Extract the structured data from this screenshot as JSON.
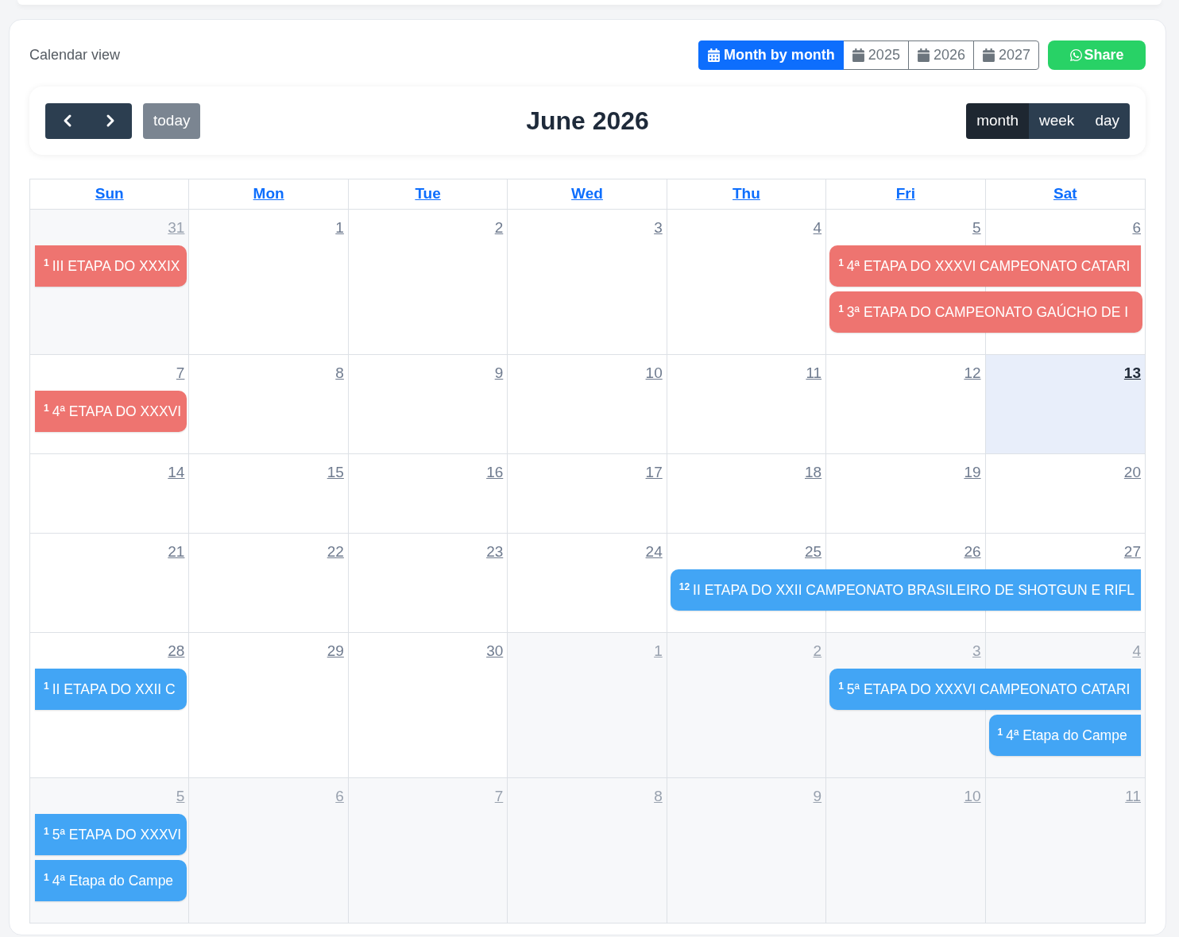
{
  "header": {
    "title": "Calendar view",
    "view_modes": [
      {
        "label": "Month by month",
        "kind": "months",
        "selected": true
      },
      {
        "label": "2025",
        "kind": "year",
        "selected": false
      },
      {
        "label": "2026",
        "kind": "year",
        "selected": false
      },
      {
        "label": "2027",
        "kind": "year",
        "selected": false
      }
    ],
    "share_button": {
      "label": "Share"
    }
  },
  "toolbar": {
    "title": "June 2026",
    "today_button": {
      "label": "today",
      "disabled": true
    },
    "views": [
      {
        "label": "month",
        "selected": true
      },
      {
        "label": "week",
        "selected": false
      },
      {
        "label": "day",
        "selected": false
      }
    ]
  },
  "calendar": {
    "day_headers": [
      "Sun",
      "Mon",
      "Tue",
      "Wed",
      "Thu",
      "Fri",
      "Sat"
    ],
    "weeks": [
      {
        "days": [
          {
            "number": "31",
            "other_month": true,
            "today": false,
            "events": [
              {
                "kind": "event",
                "time": "1",
                "title": "III ETAPA DO XXXIX",
                "color": "#ee7470",
                "continues_before": true,
                "continues_after": false
              }
            ]
          },
          {
            "number": "1",
            "other_month": false,
            "today": false
          },
          {
            "number": "2",
            "other_month": false,
            "today": false
          },
          {
            "number": "3",
            "other_month": false,
            "today": false
          },
          {
            "number": "4",
            "other_month": false,
            "today": false
          },
          {
            "number": "5",
            "other_month": false,
            "today": false,
            "events": [
              {
                "kind": "event",
                "time": "1",
                "title": "4ª ETAPA DO XXXVI CAMPEONATO CATARI",
                "color": "#ee7470",
                "continues_before": false,
                "continues_after": true
              },
              {
                "kind": "event",
                "time": "1",
                "title": "3ª ETAPA DO CAMPEONATO GAÚCHO DE I",
                "color": "#ee7470",
                "continues_before": false,
                "continues_after": false
              }
            ]
          },
          {
            "number": "6",
            "other_month": false,
            "today": false,
            "events": [
              {
                "kind": "continued"
              },
              {
                "kind": "continued"
              }
            ]
          }
        ]
      },
      {
        "days": [
          {
            "number": "7",
            "other_month": false,
            "today": false,
            "events": [
              {
                "kind": "event",
                "time": "1",
                "title": "4ª ETAPA DO XXXVI",
                "color": "#ee7470",
                "continues_before": true,
                "continues_after": false
              }
            ]
          },
          {
            "number": "8",
            "other_month": false,
            "today": false
          },
          {
            "number": "9",
            "other_month": false,
            "today": false
          },
          {
            "number": "10",
            "other_month": false,
            "today": false
          },
          {
            "number": "11",
            "other_month": false,
            "today": false
          },
          {
            "number": "12",
            "other_month": false,
            "today": false
          },
          {
            "number": "13",
            "other_month": false,
            "today": true
          }
        ]
      },
      {
        "days": [
          {
            "number": "14",
            "other_month": false,
            "today": false
          },
          {
            "number": "15",
            "other_month": false,
            "today": false
          },
          {
            "number": "16",
            "other_month": false,
            "today": false
          },
          {
            "number": "17",
            "other_month": false,
            "today": false
          },
          {
            "number": "18",
            "other_month": false,
            "today": false
          },
          {
            "number": "19",
            "other_month": false,
            "today": false
          },
          {
            "number": "20",
            "other_month": false,
            "today": false
          }
        ]
      },
      {
        "days": [
          {
            "number": "21",
            "other_month": false,
            "today": false
          },
          {
            "number": "22",
            "other_month": false,
            "today": false
          },
          {
            "number": "23",
            "other_month": false,
            "today": false
          },
          {
            "number": "24",
            "other_month": false,
            "today": false
          },
          {
            "number": "25",
            "other_month": false,
            "today": false,
            "events": [
              {
                "kind": "event",
                "time": "12",
                "title": "II ETAPA DO XXII CAMPEONATO BRASILEIRO DE SHOTGUN E RIFL",
                "color": "#42a5f5",
                "continues_before": false,
                "continues_after": true
              }
            ]
          },
          {
            "number": "26",
            "other_month": false,
            "today": false,
            "events": [
              {
                "kind": "continued"
              }
            ]
          },
          {
            "number": "27",
            "other_month": false,
            "today": false,
            "events": [
              {
                "kind": "continued"
              }
            ]
          }
        ]
      },
      {
        "days": [
          {
            "number": "28",
            "other_month": false,
            "today": false,
            "events": [
              {
                "kind": "event",
                "time": "1",
                "title": "II ETAPA DO XXII C",
                "color": "#42a5f5",
                "continues_before": true,
                "continues_after": false
              }
            ]
          },
          {
            "number": "29",
            "other_month": false,
            "today": false
          },
          {
            "number": "30",
            "other_month": false,
            "today": false
          },
          {
            "number": "1",
            "other_month": true,
            "today": false
          },
          {
            "number": "2",
            "other_month": true,
            "today": false
          },
          {
            "number": "3",
            "other_month": true,
            "today": false,
            "events": [
              {
                "kind": "event",
                "time": "1",
                "title": "5ª ETAPA DO XXXVI CAMPEONATO CATARI",
                "color": "#42a5f5",
                "continues_before": false,
                "continues_after": true
              }
            ]
          },
          {
            "number": "4",
            "other_month": true,
            "today": false,
            "events": [
              {
                "kind": "continued"
              },
              {
                "kind": "event",
                "time": "1",
                "title": "4ª Etapa do Campe",
                "color": "#42a5f5",
                "continues_before": false,
                "continues_after": true
              }
            ]
          }
        ]
      },
      {
        "days": [
          {
            "number": "5",
            "other_month": true,
            "today": false,
            "events": [
              {
                "kind": "event",
                "time": "1",
                "title": "5ª ETAPA DO XXXVI",
                "color": "#42a5f5",
                "continues_before": true,
                "continues_after": false
              },
              {
                "kind": "event",
                "time": "1",
                "title": "4ª Etapa do Campe",
                "color": "#42a5f5",
                "continues_before": true,
                "continues_after": false
              }
            ]
          },
          {
            "number": "6",
            "other_month": true,
            "today": false
          },
          {
            "number": "7",
            "other_month": true,
            "today": false
          },
          {
            "number": "8",
            "other_month": true,
            "today": false
          },
          {
            "number": "9",
            "other_month": true,
            "today": false
          },
          {
            "number": "10",
            "other_month": true,
            "today": false
          },
          {
            "number": "11",
            "other_month": true,
            "today": false
          }
        ]
      }
    ]
  }
}
